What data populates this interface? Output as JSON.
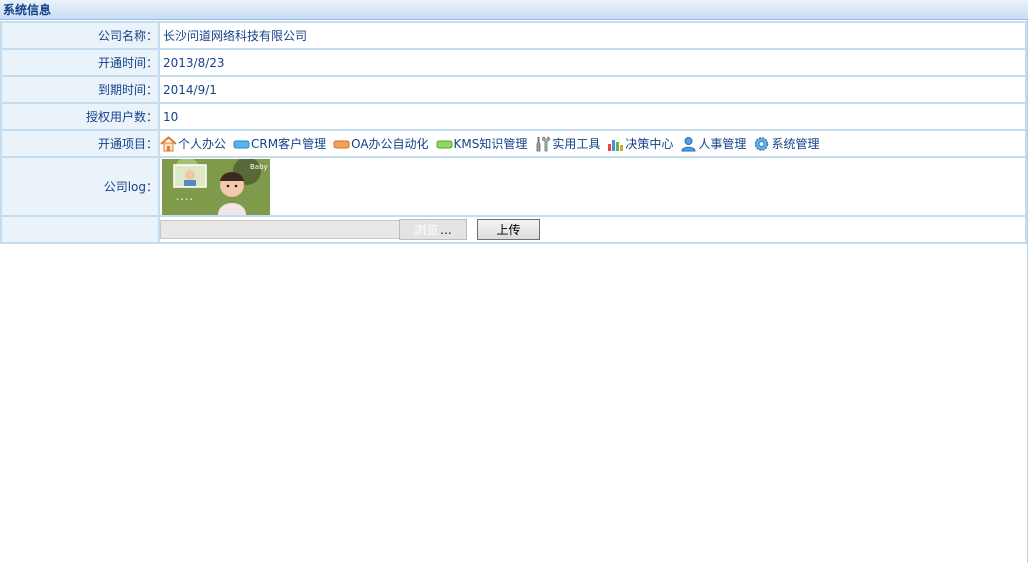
{
  "panel": {
    "title": "系统信息"
  },
  "rows": {
    "company_name": {
      "label": "公司名称：",
      "value": "长沙问道网络科技有限公司"
    },
    "open_time": {
      "label": "开通时间：",
      "value": "2013/8/23"
    },
    "expire_time": {
      "label": "到期时间：",
      "value": "2014/9/1"
    },
    "license_users": {
      "label": "授权用户数：",
      "value": "10"
    },
    "modules": {
      "label": "开通项目：",
      "items": [
        {
          "label": "个人办公",
          "icon": "home-icon"
        },
        {
          "label": "CRM客户管理",
          "icon": "crm-icon"
        },
        {
          "label": "OA办公自动化",
          "icon": "oa-icon"
        },
        {
          "label": "KMS知识管理",
          "icon": "kms-icon"
        },
        {
          "label": "实用工具",
          "icon": "tools-icon"
        },
        {
          "label": "决策中心",
          "icon": "chart-icon"
        },
        {
          "label": "人事管理",
          "icon": "person-icon"
        },
        {
          "label": "系统管理",
          "icon": "gear-icon"
        }
      ]
    },
    "logo": {
      "label": "公司log："
    }
  },
  "upload": {
    "file_value": "",
    "browse_ghost": "浏览",
    "browse_label": "...",
    "upload_label": "上传"
  },
  "colors": {
    "label_bg": "#eaf2fa",
    "border": "#c4dcef",
    "text": "#15428b"
  }
}
